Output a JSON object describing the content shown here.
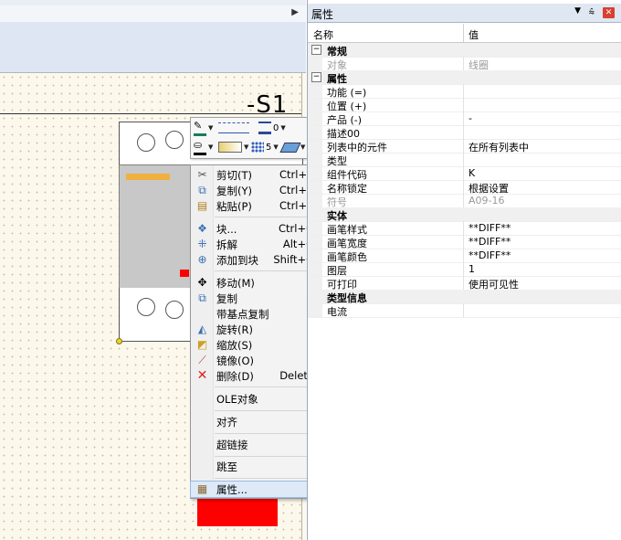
{
  "canvas": {
    "symbol_label": "-S1"
  },
  "context_menu": {
    "items": [
      {
        "label": "剪切(T)",
        "shortcut": "Ctrl+X",
        "icon": "scissors-icon"
      },
      {
        "label": "复制(Y)",
        "shortcut": "Ctrl+C",
        "icon": "copy-icon"
      },
      {
        "label": "粘贴(P)",
        "shortcut": "Ctrl+V",
        "icon": "paste-icon"
      },
      {
        "label": "块...",
        "shortcut": "Ctrl+G",
        "icon": "block-icon"
      },
      {
        "label": "拆解",
        "shortcut": "Alt+G",
        "icon": "explode-icon"
      },
      {
        "label": "添加到块",
        "shortcut": "Shift+G",
        "icon": "add-to-block-icon"
      },
      {
        "label": "移动(M)",
        "shortcut": "",
        "icon": "move-icon"
      },
      {
        "label": "复制",
        "shortcut": "",
        "icon": "duplicate-icon"
      },
      {
        "label": "带基点复制",
        "shortcut": "",
        "icon": ""
      },
      {
        "label": "旋转(R)",
        "shortcut": "",
        "icon": "rotate-icon"
      },
      {
        "label": "缩放(S)",
        "shortcut": "",
        "icon": "scale-icon"
      },
      {
        "label": "镜像(O)",
        "shortcut": "",
        "icon": "mirror-icon"
      },
      {
        "label": "删除(D)",
        "shortcut": "Delete",
        "icon": "delete-icon"
      },
      {
        "label": "OLE对象",
        "shortcut": "",
        "icon": ""
      },
      {
        "label": "对齐",
        "shortcut": "",
        "icon": ""
      },
      {
        "label": "超链接",
        "shortcut": "",
        "icon": ""
      },
      {
        "label": "跳至",
        "shortcut": "",
        "icon": ""
      },
      {
        "label": "属性...",
        "shortcut": "",
        "icon": "properties-icon"
      }
    ]
  },
  "mini_toolbar": {
    "line_width_value": "0",
    "hatch_value": "5"
  },
  "properties_panel": {
    "title": "属性",
    "pin_glyph": "⩯",
    "columns": {
      "name": "名称",
      "value": "值"
    },
    "sections": [
      {
        "label": "常规",
        "toggle": "−",
        "rows": [
          {
            "name": "对象",
            "value": "线圈",
            "grey": true
          }
        ]
      },
      {
        "label": "属性",
        "toggle": "−",
        "rows": [
          {
            "name": "功能 (=)",
            "value": "",
            "grey": false
          },
          {
            "name": "位置 (+)",
            "value": "",
            "grey": false
          },
          {
            "name": "产品 (-)",
            "value": "-",
            "grey": false
          },
          {
            "name": "描述00",
            "value": "",
            "grey": false
          },
          {
            "name": "列表中的元件",
            "value": "在所有列表中",
            "grey": false
          },
          {
            "name": "类型",
            "value": "",
            "grey": false
          },
          {
            "name": "组件代码",
            "value": "K",
            "grey": false
          },
          {
            "name": "名称锁定",
            "value": "根据设置",
            "grey": false
          },
          {
            "name": "符号",
            "value": "A09-16",
            "grey": true
          }
        ]
      },
      {
        "label": "实体",
        "toggle": "",
        "rows": [
          {
            "name": "画笔样式",
            "value": "**DIFF**",
            "grey": false
          },
          {
            "name": "画笔宽度",
            "value": "**DIFF**",
            "grey": false
          },
          {
            "name": "画笔颜色",
            "value": "**DIFF**",
            "grey": false
          },
          {
            "name": "图层",
            "value": "1",
            "grey": false
          },
          {
            "name": "可打印",
            "value": "使用可见性",
            "grey": false
          }
        ]
      },
      {
        "label": "类型信息",
        "toggle": "",
        "rows": [
          {
            "name": "电流",
            "value": "",
            "grey": false
          }
        ]
      }
    ]
  },
  "colors": {
    "accent_red": "#ff0000",
    "highlight": "#dde9f7"
  }
}
